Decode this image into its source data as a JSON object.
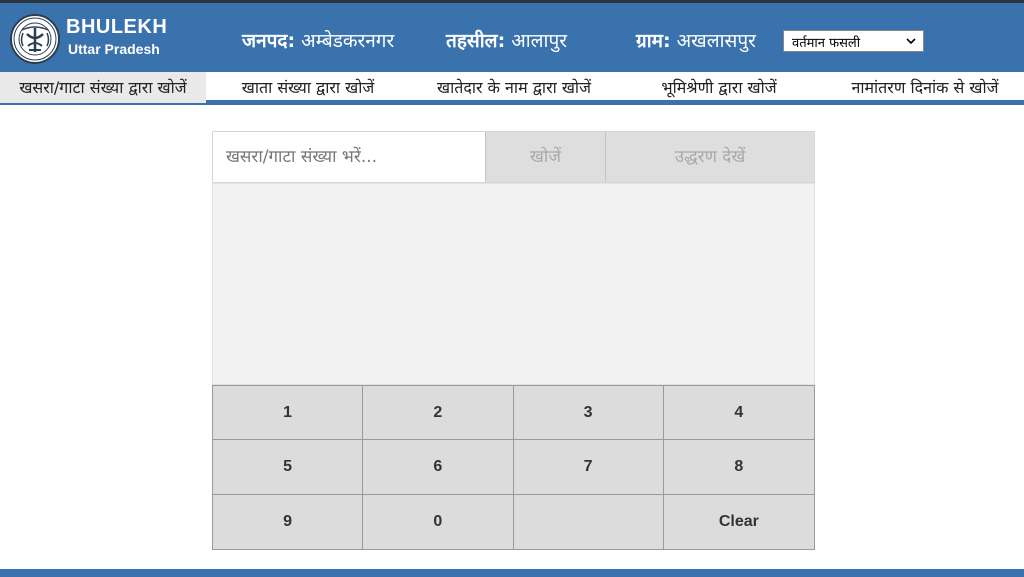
{
  "header": {
    "brand_title": "BHULEKH",
    "brand_subtitle": "Uttar Pradesh",
    "locations": [
      {
        "label": "जनपद:",
        "value": "अम्बेडकरनगर"
      },
      {
        "label": "तहसील:",
        "value": "आलापुर"
      },
      {
        "label": "ग्राम:",
        "value": "अखलासपुर"
      }
    ],
    "year_select": {
      "selected": "वर्तमान फसली"
    }
  },
  "tabs": [
    {
      "label": "खसरा/गाटा संख्या द्वारा खोजें",
      "active": true
    },
    {
      "label": "खाता संख्या द्वारा खोजें",
      "active": false
    },
    {
      "label": "खातेदार के नाम द्वारा खोजें",
      "active": false
    },
    {
      "label": "भूमिश्रेणी द्वारा खोजें",
      "active": false
    },
    {
      "label": "नामांतरण दिनांक से खोजें",
      "active": false
    }
  ],
  "search": {
    "placeholder": "खसरा/गाटा संख्या भरें...",
    "value": "",
    "search_button": "खोजें",
    "extract_button": "उद्धरण देखें"
  },
  "keypad": {
    "keys": [
      "1",
      "2",
      "3",
      "4",
      "5",
      "6",
      "7",
      "8",
      "9",
      "0",
      "",
      "Clear"
    ]
  },
  "colors": {
    "header_bg": "#3a72ae",
    "active_tab_bg": "#e9e9e9",
    "key_bg": "#dcdcdc"
  }
}
